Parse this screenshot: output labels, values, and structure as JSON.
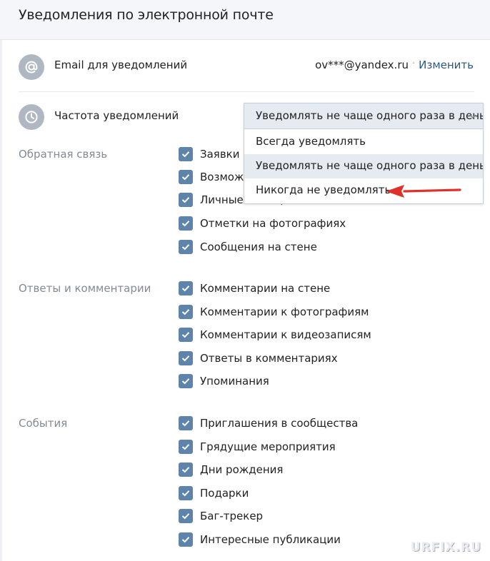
{
  "header": {
    "title": "Уведомления по электронной почте"
  },
  "email_row": {
    "icon": "at-icon",
    "label": "Email для уведомлений",
    "value": "ov***@yandex.ru",
    "separator": "·",
    "change_label": "Изменить"
  },
  "frequency_row": {
    "icon": "clock-icon",
    "label": "Частота уведомлений"
  },
  "dropdown": {
    "selected": "Уведомлять не чаще одного раза в день",
    "options": [
      "Всегда уведомлять",
      "Уведомлять не чаще одного раза в день",
      "Никогда не уведомлять"
    ],
    "hovered_index": 1
  },
  "sections": [
    {
      "label": "Обратная связь",
      "items": [
        "Заявки в друзья",
        "Возможные друзья",
        "Личные сообщения",
        "Отметки на фотографиях",
        "Сообщения на стене"
      ]
    },
    {
      "label": "Ответы и комментарии",
      "items": [
        "Комментарии на стене",
        "Комментарии к фотографиям",
        "Комментарии к видеозаписям",
        "Ответы в комментариях",
        "Упоминания"
      ]
    },
    {
      "label": "События",
      "items": [
        "Приглашения в сообщества",
        "Грядущие мероприятия",
        "Дни рождения",
        "Подарки",
        "Баг-трекер",
        "Интересные публикации"
      ]
    }
  ],
  "annotation": {
    "arrow_color": "#e0302a"
  },
  "colors": {
    "checkbox": "#5f84ac",
    "link": "#2a5885",
    "section_label": "#828b95"
  },
  "watermark": "URFIX.RU"
}
